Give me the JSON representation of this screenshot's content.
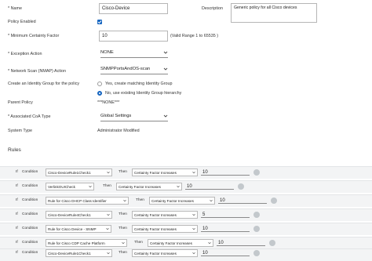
{
  "form": {
    "name_label": "* Name",
    "name_value": "Cisco-Device",
    "description_label": "Description",
    "description_value": "Generic policy for all Cisco devices",
    "policy_enabled_label": "Policy Enabled",
    "policy_enabled": true,
    "min_cf_label": "* Minimum Certainty Factor",
    "min_cf_value": "10",
    "min_cf_hint": "(Valid Range 1 to 65535 )",
    "exception_label": "* Exception Action",
    "exception_value": "NONE",
    "nmap_label": "* Network Scan (NMAP) Action",
    "nmap_value": "SNMPPortsAndOS-scan",
    "identity_group_label": "Create an Identity Group for the policy",
    "identity_option_yes": "Yes, create matching Identity Group",
    "identity_option_no": "No, use existing Identity Group hierarchy",
    "identity_selected": "no",
    "parent_label": "Parent Policy",
    "parent_value": "***NONE***",
    "coa_label": "* Associated CoA Type",
    "coa_value": "Global Settings",
    "system_type_label": "System Type",
    "system_type_value": "Administrator Modified"
  },
  "rules": {
    "title": "Rules",
    "if_label": "If",
    "condition_label": "Condition",
    "then_label": "Then",
    "rows": [
      {
        "condition": "Cisco-DeviceRule1Check1",
        "action": "Certainty Factor Increases",
        "value": "10"
      },
      {
        "condition": "VerlinkOUICheck",
        "action": "Certainty Factor Increases",
        "value": "10"
      },
      {
        "condition": "Rule for Cisco DHCP Class Identifier",
        "action": "Certainty Factor Increases",
        "value": "10"
      },
      {
        "condition": "Cisco-DeviceRule4Check1",
        "action": "Certainty Factor Increases",
        "value": "5"
      },
      {
        "condition": "Rule for Cisco Device - SNMP",
        "action": "Certainty Factor Increases",
        "value": "10"
      },
      {
        "condition": "Rule for Cisco CDP Cache Platform",
        "action": "Certainty Factor Increases",
        "value": "10"
      },
      {
        "condition": "Cisco-DeviceRule1Check1",
        "action": "Certainty Factor Increases",
        "value": "10"
      }
    ]
  },
  "icons": {
    "dropdown": "chevron-down-icon",
    "settings": "gear-icon",
    "checkbox": "checkmark-icon"
  },
  "colors": {
    "accent": "#1565c0",
    "rule_row_bg": "#f3f4f5",
    "gear": "#c3c8cc"
  }
}
